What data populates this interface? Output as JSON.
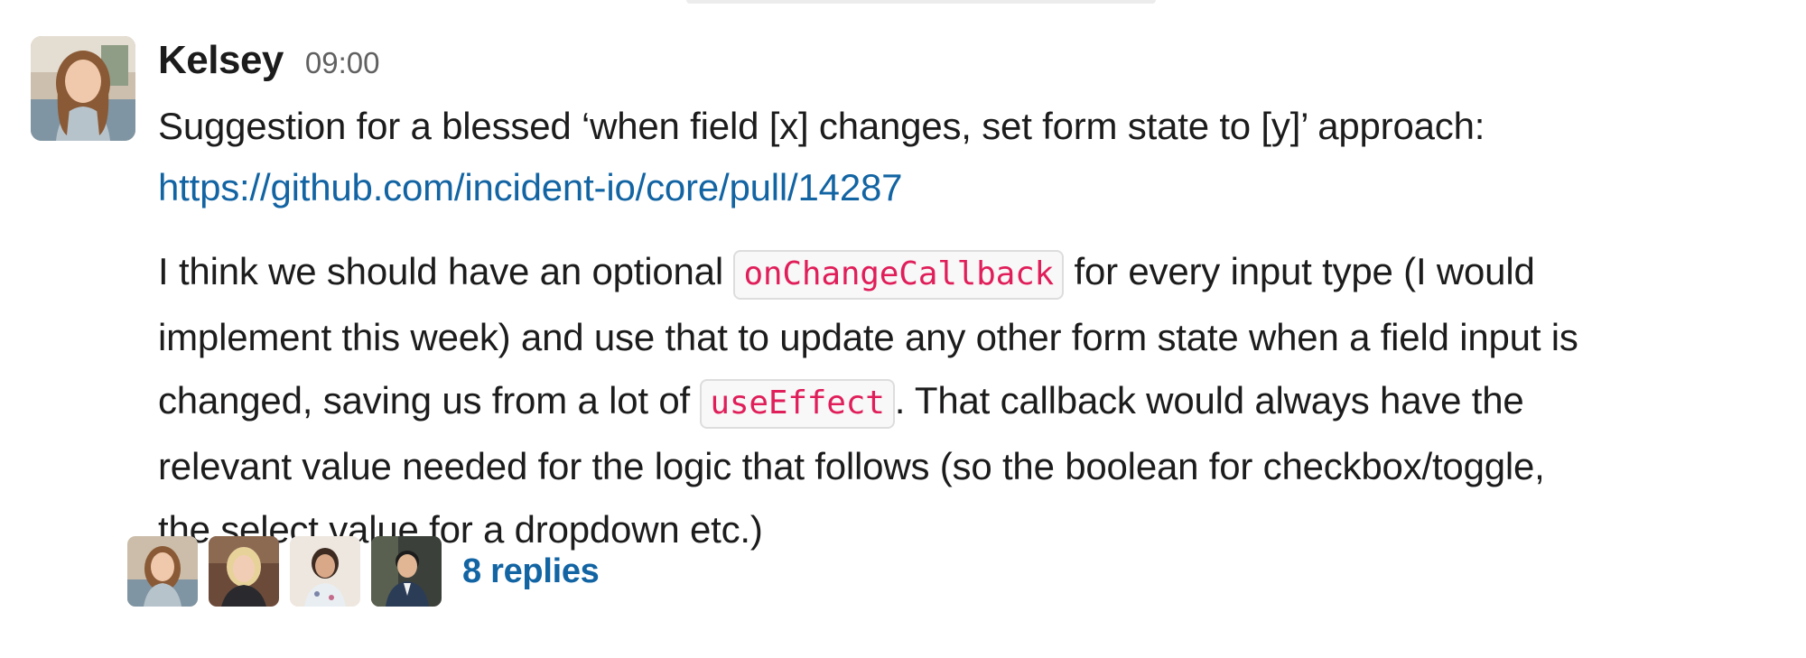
{
  "message": {
    "author": "Kelsey",
    "time": "09:00",
    "intro": "Suggestion for a blessed ‘when field [x] changes, set form state to [y]’ approach:",
    "link": "https://github.com/incident-io/core/pull/14287",
    "body": {
      "l1_before": "I think we should have an optional ",
      "code1": "onChangeCallback",
      "l1_after": " for every input type (I would",
      "l2": "implement this week) and use that to update any other form state when a field input is",
      "l3_before": "changed, saving us from a lot of ",
      "code2": "useEffect",
      "l3_after": ". That callback would always have the",
      "l4": "relevant value needed for the logic that follows (so the boolean for checkbox/toggle,",
      "l5": "the select value for a dropdown etc.)"
    }
  },
  "thread": {
    "replies_label": "8 replies"
  },
  "colors": {
    "link": "#1264a3",
    "code_text": "#e01e5a",
    "timestamp": "#616061"
  }
}
